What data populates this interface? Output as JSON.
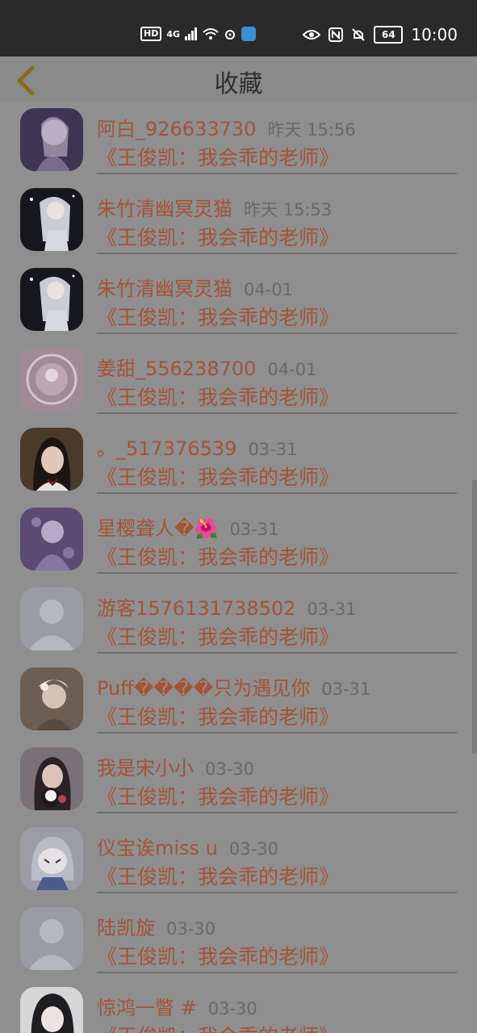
{
  "status_bar": {
    "hd": "HD",
    "network": "4G",
    "battery": "64",
    "time": "10:00"
  },
  "header": {
    "title": "收藏",
    "back_icon": "chevron-left-icon"
  },
  "favorites": [
    {
      "name": "阿白_926633730",
      "time": "昨天 15:56",
      "work": "《王俊凯：我会乖的老师》",
      "avatar": "anime-girl-purple"
    },
    {
      "name": "朱竹清幽冥灵猫",
      "time": "昨天 15:53",
      "work": "《王俊凯：我会乖的老师》",
      "avatar": "anime-white-hair"
    },
    {
      "name": "朱竹清幽冥灵猫",
      "time": "04-01",
      "work": "《王俊凯：我会乖的老师》",
      "avatar": "anime-white-hair"
    },
    {
      "name": "姜甜_556238700",
      "time": "04-01",
      "work": "《王俊凯：我会乖的老师》",
      "avatar": "pink-circle"
    },
    {
      "name": "。_517376539",
      "time": "03-31",
      "work": "《王俊凯：我会乖的老师》",
      "avatar": "girl-photo"
    },
    {
      "name": "星樱聋人�🌺",
      "time": "03-31",
      "work": "《王俊凯：我会乖的老师》",
      "avatar": "anime-purple"
    },
    {
      "name": "游客1576131738502",
      "time": "03-31",
      "work": "《王俊凯：我会乖的老师》",
      "avatar": "default-user"
    },
    {
      "name": "Puff����只为遇见你",
      "time": "03-31",
      "work": "《王俊凯：我会乖的老师》",
      "avatar": "girl-bow"
    },
    {
      "name": "我是宋小小",
      "time": "03-30",
      "work": "《王俊凯：我会乖的老师》",
      "avatar": "girl-plush"
    },
    {
      "name": "仪宝诶miss u",
      "time": "03-30",
      "work": "《王俊凯：我会乖的老师》",
      "avatar": "anime-cute"
    },
    {
      "name": "陆凯旋",
      "time": "03-30",
      "work": "《王俊凯：我会乖的老师》",
      "avatar": "default-user"
    },
    {
      "name": "惊鸿一瞥 #",
      "time": "03-30",
      "work": "《王俊凯：我会乖的老师》",
      "avatar": "anime-dark-hair"
    }
  ]
}
